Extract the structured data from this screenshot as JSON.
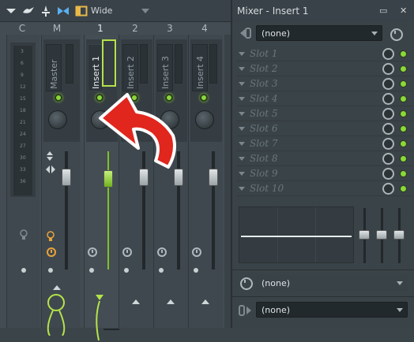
{
  "toolbar": {
    "view_label": "Wide"
  },
  "track_headers": [
    "C",
    "M",
    "1",
    "2",
    "3",
    "4"
  ],
  "meter_scale": [
    "3",
    "6",
    "9",
    "12",
    "15",
    "18",
    "21",
    "24",
    "27",
    "30",
    "33",
    "36",
    "39"
  ],
  "tracks": [
    {
      "name": "Master"
    },
    {
      "name": "Insert 1"
    },
    {
      "name": "Insert 2"
    },
    {
      "name": "Insert 3"
    },
    {
      "name": "Insert 4"
    }
  ],
  "right_panel": {
    "title": "Mixer - Insert 1",
    "minimize_glyph": "▭",
    "close_glyph": "✕",
    "input_select": "(none)",
    "slots": [
      "Slot 1",
      "Slot 2",
      "Slot 3",
      "Slot 4",
      "Slot 5",
      "Slot 6",
      "Slot 7",
      "Slot 8",
      "Slot 9",
      "Slot 10"
    ],
    "latency_select": "(none)",
    "output_select": "(none)"
  },
  "colors": {
    "accent_green": "#8ad83a",
    "annotation_red": "#e0261d",
    "selected_outline": "#8ad83a"
  }
}
